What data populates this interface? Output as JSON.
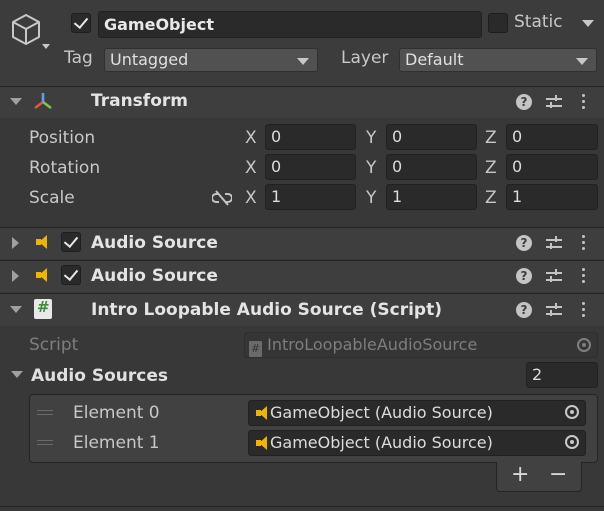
{
  "object": {
    "name": "GameObject",
    "active": true,
    "static_label": "Static",
    "static_checked": false,
    "tag_label": "Tag",
    "tag_value": "Untagged",
    "layer_label": "Layer",
    "layer_value": "Default"
  },
  "transform": {
    "title": "Transform",
    "rows": [
      {
        "label": "Position",
        "x": "0",
        "y": "0",
        "z": "0"
      },
      {
        "label": "Rotation",
        "x": "0",
        "y": "0",
        "z": "0"
      },
      {
        "label": "Scale",
        "x": "1",
        "y": "1",
        "z": "1"
      }
    ],
    "axis": {
      "x": "X",
      "y": "Y",
      "z": "Z"
    }
  },
  "components": [
    {
      "title": "Audio Source",
      "enabled": true
    },
    {
      "title": "Audio Source",
      "enabled": true
    }
  ],
  "script_component": {
    "title": "Intro Loopable Audio Source (Script)",
    "script_label": "Script",
    "script_value": "IntroLoopableAudioSource",
    "list_label": "Audio Sources",
    "list_count": "2",
    "elements": [
      {
        "label": "Element 0",
        "value": "GameObject (Audio Source)"
      },
      {
        "label": "Element 1",
        "value": "GameObject (Audio Source)"
      }
    ],
    "add_label": "+",
    "remove_label": "−"
  },
  "icons": {
    "help": "?",
    "hash": "#"
  },
  "colors": {
    "background": "#383838",
    "header": "#3e3e3e",
    "field": "#2a2a2a",
    "audio_icon": "#f0b400",
    "script_icon": "#3c8c3c"
  }
}
